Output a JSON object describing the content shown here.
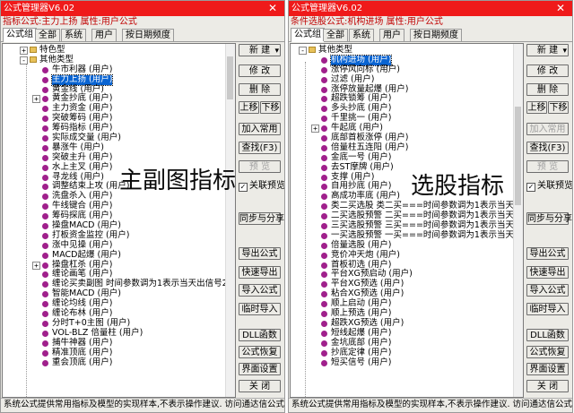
{
  "left": {
    "title": "公式管理器V6.02",
    "subtitle": "指标公式:主力上扬 属性:用户公式",
    "tabs": [
      "公式组",
      "全部",
      "系统",
      "用户",
      "按日期频度"
    ],
    "overlay": "主副图指标",
    "status": "系统公式提供常用指标及模型的实现样本,不表示操作建议.  访问通达信公式讨论区",
    "tree": [
      {
        "text": "特色型",
        "level": 0,
        "kind": "folder",
        "exp": "+"
      },
      {
        "text": "其他类型",
        "level": 0,
        "kind": "folder",
        "exp": "-"
      },
      {
        "text": "牛市利器    (用户)",
        "level": 1,
        "kind": "item"
      },
      {
        "text": "主力上扬    (用户)",
        "level": 1,
        "kind": "item",
        "selected": true
      },
      {
        "text": "黄金线      (用户)",
        "level": 1,
        "kind": "item"
      },
      {
        "text": "黄金抄底    (用户)",
        "level": 1,
        "kind": "item",
        "exp": "+"
      },
      {
        "text": "主力资金    (用户)",
        "level": 1,
        "kind": "item"
      },
      {
        "text": "突破筹码    (用户)",
        "level": 1,
        "kind": "item"
      },
      {
        "text": "筹码指标    (用户)",
        "level": 1,
        "kind": "item"
      },
      {
        "text": "实际成交量  (用户)",
        "level": 1,
        "kind": "item"
      },
      {
        "text": "暴涨牛    (用户)",
        "level": 1,
        "kind": "item"
      },
      {
        "text": "突破主升    (用户)",
        "level": 1,
        "kind": "item"
      },
      {
        "text": "水上主叉    (用户)",
        "level": 1,
        "kind": "item"
      },
      {
        "text": "寻龙线    (用户)",
        "level": 1,
        "kind": "item"
      },
      {
        "text": "调整结束上攻    (用户)",
        "level": 1,
        "kind": "item"
      },
      {
        "text": "洗盘杀入    (用户)",
        "level": 1,
        "kind": "item"
      },
      {
        "text": "牛线键合    (用户)",
        "level": 1,
        "kind": "item"
      },
      {
        "text": "筹码探底    (用户)",
        "level": 1,
        "kind": "item"
      },
      {
        "text": "操盘MACD    (用户)",
        "level": 1,
        "kind": "item"
      },
      {
        "text": "打板资金监控    (用户)",
        "level": 1,
        "kind": "item"
      },
      {
        "text": "涨中见操    (用户)",
        "level": 1,
        "kind": "item"
      },
      {
        "text": "MACD起爆    (用户)",
        "level": 1,
        "kind": "item"
      },
      {
        "text": "操盘杠杀    (用户)",
        "level": 1,
        "kind": "item",
        "exp": "+"
      },
      {
        "text": "缠论画笔    (用户)",
        "level": 1,
        "kind": "item"
      },
      {
        "text": "缠论买卖副图    时间参数调为1表示当天出信号2表:",
        "level": 1,
        "kind": "item"
      },
      {
        "text": "智能MACD    (用户)",
        "level": 1,
        "kind": "item"
      },
      {
        "text": "缠论均线    (用户)",
        "level": 1,
        "kind": "item"
      },
      {
        "text": "缠论布林    (用户)",
        "level": 1,
        "kind": "item"
      },
      {
        "text": "分时T+0主图    (用户)",
        "level": 1,
        "kind": "item"
      },
      {
        "text": "VOL-BLZ    倍量柱    (用户)",
        "level": 1,
        "kind": "item"
      },
      {
        "text": "捕牛神器    (用户)",
        "level": 1,
        "kind": "item"
      },
      {
        "text": "精准顶底    (用户)",
        "level": 1,
        "kind": "item"
      },
      {
        "text": "重会顶底    (用户)",
        "level": 1,
        "kind": "item"
      }
    ],
    "buttons": [
      "新  建",
      "修  改",
      "删  除",
      "上移",
      "下移",
      "加入常用",
      "查找(F3)",
      "预  览",
      "同步与分享",
      "导出公式",
      "快速导出",
      "导入公式",
      "临时导入",
      "DLL函数",
      "公式恢复",
      "界面设置",
      "关  闭"
    ],
    "disabled": [
      "预  览"
    ],
    "checkbox": "关联预览",
    "checkbox_checked": true
  },
  "right": {
    "title": "公式管理器V6.02",
    "subtitle": "条件选股公式:机构进场 属性:用户公式",
    "tabs": [
      "公式组",
      "全部",
      "系统",
      "用户",
      "按日期频度"
    ],
    "overlay": "选股指标",
    "status": "系统公式提供常用指标及模型的实现样本,不表示操作建议.  访问通达信公式讨论区",
    "tree": [
      {
        "text": "其他类型",
        "level": 0,
        "kind": "folder",
        "exp": "-"
      },
      {
        "text": "机构进场    (用户)",
        "level": 1,
        "kind": "item",
        "selected": true
      },
      {
        "text": "涨停风向标    (用户)",
        "level": 1,
        "kind": "item"
      },
      {
        "text": "过滤    (用户)",
        "level": 1,
        "kind": "item"
      },
      {
        "text": "涨停放量起爆    (用户)",
        "level": 1,
        "kind": "item"
      },
      {
        "text": "超跌锁筹    (用户)",
        "level": 1,
        "kind": "item"
      },
      {
        "text": "多头抄底    (用户)",
        "level": 1,
        "kind": "item"
      },
      {
        "text": "千里挑一    (用户)",
        "level": 1,
        "kind": "item"
      },
      {
        "text": "牛起底    (用户)",
        "level": 1,
        "kind": "item",
        "exp": "+"
      },
      {
        "text": "底部首板涨停    (用户)",
        "level": 1,
        "kind": "item"
      },
      {
        "text": "倍量柱五连阳    (用户)",
        "level": 1,
        "kind": "item"
      },
      {
        "text": "金底一号    (用户)",
        "level": 1,
        "kind": "item"
      },
      {
        "text": "去ST摩牌    (用户)",
        "level": 1,
        "kind": "item"
      },
      {
        "text": "支撑    (用户)",
        "level": 1,
        "kind": "item"
      },
      {
        "text": "自用抄底    (用户)",
        "level": 1,
        "kind": "item"
      },
      {
        "text": "高成功率底    (用户)",
        "level": 1,
        "kind": "item"
      },
      {
        "text": "类二买选股    类二买===时间参数调为1表示当天出",
        "level": 1,
        "kind": "item"
      },
      {
        "text": "二买选股预警    二买===时间参数调为1表示当天出",
        "level": 1,
        "kind": "item"
      },
      {
        "text": "三买选股预警    三买===时间参数调为1表示当天出",
        "level": 1,
        "kind": "item"
      },
      {
        "text": "一买选股预警    一买===时间参数调为1表示当天出",
        "level": 1,
        "kind": "item"
      },
      {
        "text": "倍量选股    (用户)",
        "level": 1,
        "kind": "item"
      },
      {
        "text": "竞价冲天炮    (用户)",
        "level": 1,
        "kind": "item"
      },
      {
        "text": "首板初选    (用户)",
        "level": 1,
        "kind": "item"
      },
      {
        "text": "平台XG预启动    (用户)",
        "level": 1,
        "kind": "item"
      },
      {
        "text": "平台XG预选    (用户)",
        "level": 1,
        "kind": "item"
      },
      {
        "text": "粘合XG预选    (用户)",
        "level": 1,
        "kind": "item"
      },
      {
        "text": "顺上启动    (用户)",
        "level": 1,
        "kind": "item"
      },
      {
        "text": "顺上预选    (用户)",
        "level": 1,
        "kind": "item"
      },
      {
        "text": "超跌XG预选    (用户)",
        "level": 1,
        "kind": "item"
      },
      {
        "text": "短线起爆    (用户)",
        "level": 1,
        "kind": "item"
      },
      {
        "text": "金坑底部    (用户)",
        "level": 1,
        "kind": "item"
      },
      {
        "text": "抄底定律    (用户)",
        "level": 1,
        "kind": "item"
      },
      {
        "text": "短买信号    (用户)",
        "level": 1,
        "kind": "item"
      }
    ],
    "buttons": [
      "新  建",
      "修  改",
      "删  除",
      "上移",
      "下移",
      "加入常用",
      "查找(F3)",
      "预  览",
      "同步与分享",
      "导出公式",
      "快速导出",
      "导入公式",
      "临时导入",
      "DLL函数",
      "公式恢复",
      "界面设置",
      "关  闭"
    ],
    "disabled": [
      "加入常用",
      "预  览"
    ],
    "checkbox": "关联预览",
    "checkbox_checked": true
  },
  "colors": {
    "titlebar": "#ef1a1a",
    "selection": "#0a64d2",
    "item_icon": "#a0208c"
  },
  "icons": {
    "close": "close-icon",
    "folder": "folder-icon",
    "item": "formula-icon",
    "dropdown": "dropdown-arrow-icon"
  }
}
